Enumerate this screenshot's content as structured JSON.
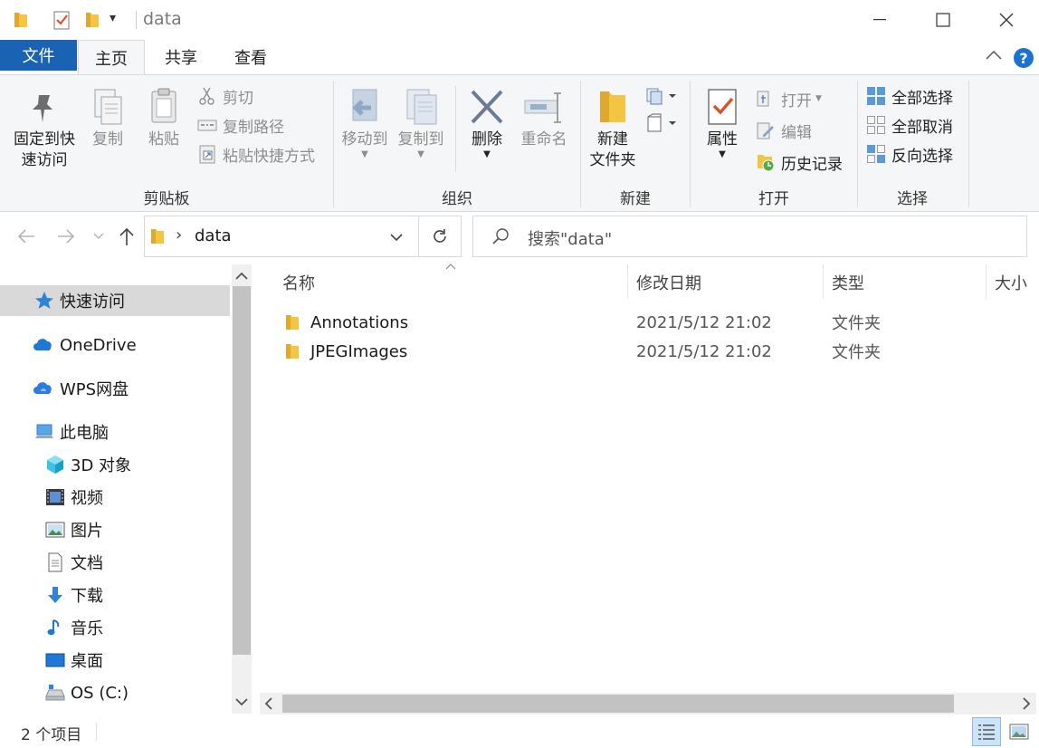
{
  "window": {
    "title": "data",
    "qat_dropdown": "▾"
  },
  "tabs": [
    {
      "label": "文件"
    },
    {
      "label": "主页"
    },
    {
      "label": "共享"
    },
    {
      "label": "查看"
    }
  ],
  "ribbon": {
    "clipboard": {
      "group_label": "剪贴板",
      "pin_line1": "固定到快",
      "pin_line2": "速访问",
      "copy": "复制",
      "paste": "粘贴",
      "cut": "剪切",
      "copy_path": "复制路径",
      "paste_shortcut": "粘贴快捷方式"
    },
    "organize": {
      "group_label": "组织",
      "move_to": "移动到",
      "copy_to": "复制到",
      "delete": "删除",
      "rename": "重命名"
    },
    "new": {
      "group_label": "新建",
      "new_folder_line1": "新建",
      "new_folder_line2": "文件夹"
    },
    "open": {
      "group_label": "打开",
      "properties": "属性",
      "open": "打开",
      "edit": "编辑",
      "history": "历史记录"
    },
    "select": {
      "group_label": "选择",
      "select_all": "全部选择",
      "select_none": "全部取消",
      "invert": "反向选择"
    }
  },
  "address": {
    "path": "data",
    "separator": "›",
    "search_placeholder": "搜索\"data\""
  },
  "sidebar": {
    "items": [
      {
        "label": "快速访问",
        "icon": "star-icon"
      },
      {
        "label": "OneDrive",
        "icon": "cloud-icon"
      },
      {
        "label": "WPS网盘",
        "icon": "cloud-icon"
      },
      {
        "label": "此电脑",
        "icon": "computer-icon"
      },
      {
        "label": "3D 对象",
        "icon": "cube-icon"
      },
      {
        "label": "视频",
        "icon": "video-icon"
      },
      {
        "label": "图片",
        "icon": "picture-icon"
      },
      {
        "label": "文档",
        "icon": "document-icon"
      },
      {
        "label": "下载",
        "icon": "download-icon"
      },
      {
        "label": "音乐",
        "icon": "music-icon"
      },
      {
        "label": "桌面",
        "icon": "desktop-icon"
      },
      {
        "label": "OS (C:)",
        "icon": "drive-icon"
      }
    ]
  },
  "filelist": {
    "columns": {
      "name": "名称",
      "modified": "修改日期",
      "type": "类型",
      "size": "大小"
    },
    "rows": [
      {
        "name": "Annotations",
        "modified": "2021/5/12 21:02",
        "type": "文件夹"
      },
      {
        "name": "JPEGImages",
        "modified": "2021/5/12 21:02",
        "type": "文件夹"
      }
    ]
  },
  "status": {
    "count": "2 个项目"
  },
  "colors": {
    "accent": "#1a63b4",
    "folder": "#f4c542",
    "selection": "#d9d9d9"
  }
}
